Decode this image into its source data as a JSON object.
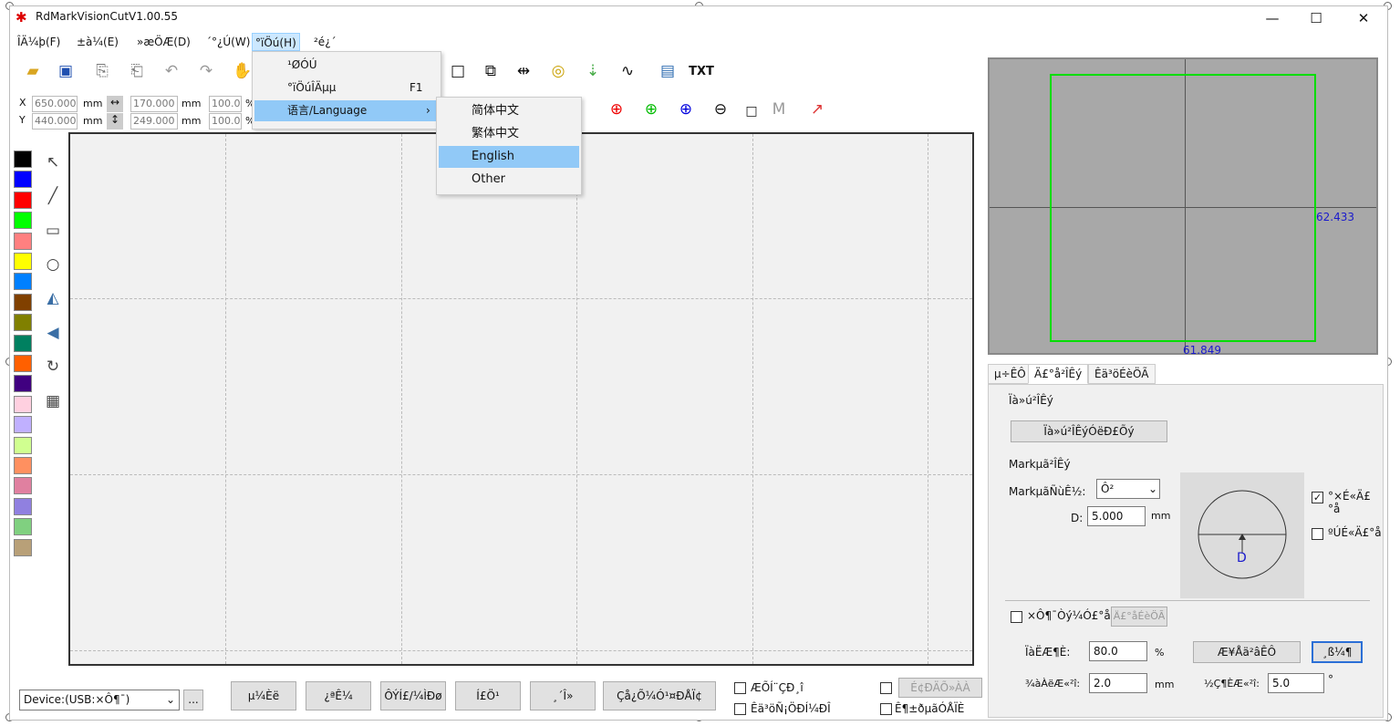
{
  "window": {
    "title": "RdMarkVisionCutV1.00.55",
    "minimize": "—",
    "maximize": "☐",
    "close": "✕"
  },
  "menubar": [
    {
      "label": "ÎÄ¼þ(F)"
    },
    {
      "label": "±à¼­(E)"
    },
    {
      "label": "»æÖÆ(D)"
    },
    {
      "label": "´°¿Ú(W)"
    },
    {
      "label": "°ïÖú(H)"
    },
    {
      "label": "²é¿´"
    }
  ],
  "help_menu": {
    "items": [
      {
        "label": "¹ØÓÚ",
        "shortcut": ""
      },
      {
        "label": "°ïÖúÎÄµµ",
        "shortcut": "F1"
      },
      {
        "label": "语言/Language",
        "shortcut": "›"
      }
    ]
  },
  "language_menu": {
    "items": [
      "简体中文",
      "繁体中文",
      "English",
      "Other"
    ],
    "selected": "English"
  },
  "toolbar": {
    "txt_label": "TXT"
  },
  "coords": {
    "x_label": "X",
    "y_label": "Y",
    "x_value": "650.000",
    "y_value": "440.000",
    "w_value": "170.000",
    "h_value": "249.000",
    "unit": "mm",
    "sx_value": "100.0",
    "sy_value": "100.0",
    "pct": "%"
  },
  "palette": [
    "#000000",
    "#0000ff",
    "#ff0000",
    "#00ff00",
    "#ff8080",
    "#ffff00",
    "#0080ff",
    "#804000",
    "#808000",
    "#008060",
    "#ff6000",
    "#400080",
    "#ffd0e0",
    "#c0b0ff",
    "#d0ff90",
    "#ff9060",
    "#e080a0",
    "#9080e0",
    "#80d080",
    "#b8a078"
  ],
  "preview": {
    "width_label": "61.849",
    "height_label": "62.433",
    "accent": "#00dd00"
  },
  "tabs": [
    "µ÷ÊÔ",
    "Ä£°å²ÎÊý",
    "Êä³öÉèÖÃ"
  ],
  "panel": {
    "group1_title": "Ïà»ú²ÎÊý",
    "group1_button": "Ïà»ú²ÎÊýÓëÐ£Õý",
    "group2_title": "Markµã²ÎÊý",
    "type_label": "MarkµãÑùÊ½:",
    "type_value": "Ô²",
    "d_label": "D:",
    "d_value": "5.000",
    "d_unit": "mm",
    "diagram_letter": "D",
    "check_white": "°×É«Ä£°å",
    "check_black": "ºÚÉ«Ä£°å",
    "white_checked": true,
    "black_checked": false,
    "auto_check": "×Ô¶¯Òý¼Ó£°å",
    "auto_btn": "Ä£°åÉèÖÃ",
    "sim_label": "ÏàËÆ¶È:",
    "sim_value": "80.0",
    "sim_unit": "%",
    "match_btn": "Æ¥Åä²âÊÔ",
    "capture_btn": "¸ß¼¶",
    "dist_label": "¾àÀëÆ«²î:",
    "dist_value": "2.0",
    "dist_unit": "mm",
    "angle_label": "½Ç¶ÈÆ«²î:",
    "angle_value": "5.0",
    "angle_unit": "°"
  },
  "bottom": {
    "device": "Device:(USB:×Ô¶¯)",
    "more": "...",
    "buttons": [
      "µ¼Èë",
      "¿ªÊ¼",
      "ÔÝÍ£/¼ÌÐø",
      "Í£Ö¹",
      "¸´Î»",
      "Çå¿Õ¼Ó¹¤ÐÅÏ¢"
    ],
    "chk1": "ÆÕÍ¨ÇÐ¸î",
    "chk2": "Êä³öÑ¡ÖÐÍ¼ÐÎ",
    "chk3": "",
    "chk4": "Ê¶±ðµãÓÅÏÈ",
    "disabled_btn": "É¢ÐÄÕ»ÀÀ"
  }
}
